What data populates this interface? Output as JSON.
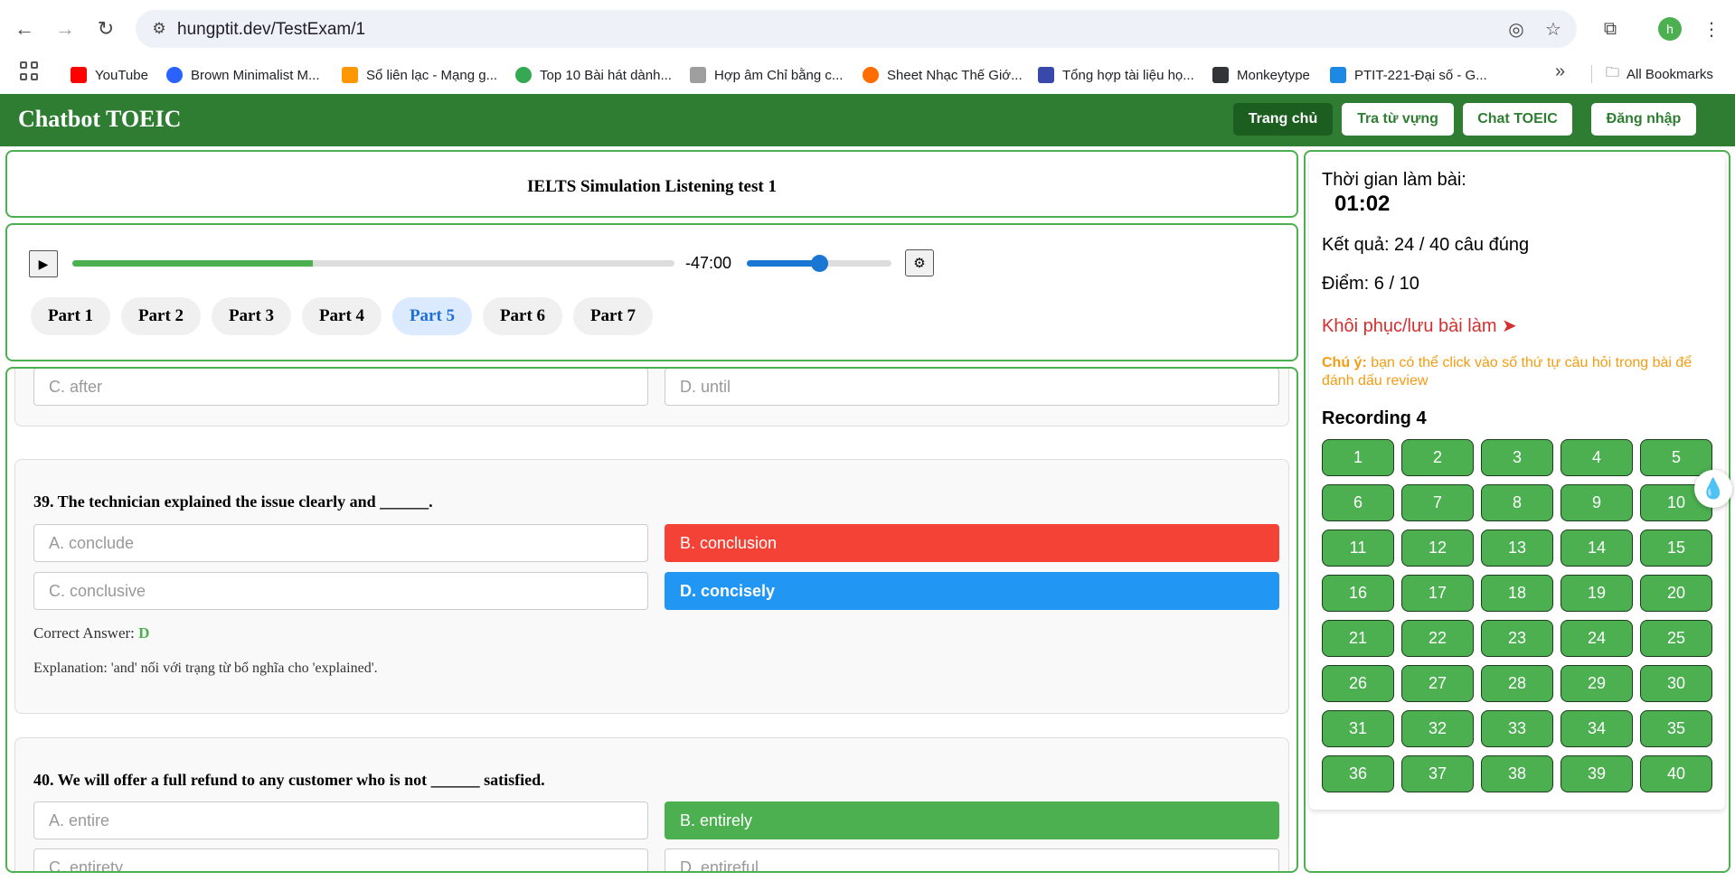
{
  "browser": {
    "url": "hungptit.dev/TestExam/1",
    "profile_initial": "h",
    "icons": {
      "back": "arrow-left-icon",
      "forward": "arrow-right-icon",
      "reload": "reload-icon",
      "site_info": "tune-icon",
      "eye_off": "eye-off-icon",
      "star": "star-icon",
      "extensions": "puzzle-icon",
      "menu": "kebab-menu-icon"
    },
    "bookmarks": [
      {
        "label": "YouTube",
        "color": "#ff0000"
      },
      {
        "label": "Brown Minimalist M...",
        "color": "#2962ff"
      },
      {
        "label": "Sổ liên lạc - Mạng g...",
        "color": "#ff9800"
      },
      {
        "label": "Top 10 Bài hát dành...",
        "color": "#34a853"
      },
      {
        "label": "Hợp âm Chỉ bằng c...",
        "color": "#9e9e9e"
      },
      {
        "label": "Sheet Nhạc Thế Giớ...",
        "color": "#ff6d00"
      },
      {
        "label": "Tổng hợp tài liệu họ...",
        "color": "#3949ab"
      },
      {
        "label": "Monkeytype",
        "color": "#323437"
      },
      {
        "label": "PTIT-221-Đại số - G...",
        "color": "#1e88e5"
      }
    ],
    "all_bookmarks": "All Bookmarks"
  },
  "app": {
    "title": "Chatbot TOEIC",
    "nav": {
      "home": "Trang chủ",
      "vocab": "Tra từ vựng",
      "chat": "Chat TOEIC",
      "login": "Đăng nhập"
    }
  },
  "exam": {
    "title": "IELTS Simulation Listening test 1"
  },
  "player": {
    "time_left": "-47:00",
    "progress": 0.4,
    "volume": 0.5,
    "parts": [
      "Part 1",
      "Part 2",
      "Part 3",
      "Part 4",
      "Part 5",
      "Part 6",
      "Part 7"
    ],
    "active_part": "Part 5"
  },
  "questions": {
    "prev_tail": {
      "c": "C. after",
      "d": "D. until"
    },
    "q39": {
      "text": "39. The technician explained the issue clearly and ______.",
      "a": "A. conclude",
      "b": "B. conclusion",
      "c": "C. conclusive",
      "d": "D. concisely",
      "answer_label": "Correct Answer: ",
      "answer": "D",
      "explanation": "Explanation: 'and' nối với trạng từ bổ nghĩa cho 'explained'."
    },
    "q40": {
      "text": "40. We will offer a full refund to any customer who is not ______ satisfied.",
      "a": "A. entire",
      "b": "B. entirely",
      "c": "C. entirety",
      "d": "D. entireful"
    }
  },
  "sidebar": {
    "time_label": "Thời gian làm bài:",
    "timer": "01:02",
    "result": "Kết quả: 24 / 40 câu đúng",
    "score": "Điểm: 6 / 10",
    "restore": "Khôi phục/lưu bài làm ➤",
    "note_label": "Chú ý:",
    "note_text": " bạn có thể click vào số thứ tự câu hỏi trong bài để đánh dấu review",
    "section": "Recording 4",
    "numbers": [
      "1",
      "2",
      "3",
      "4",
      "5",
      "6",
      "7",
      "8",
      "9",
      "10",
      "11",
      "12",
      "13",
      "14",
      "15",
      "16",
      "17",
      "18",
      "19",
      "20",
      "21",
      "22",
      "23",
      "24",
      "25",
      "26",
      "27",
      "28",
      "29",
      "30",
      "31",
      "32",
      "33",
      "34",
      "35",
      "36",
      "37",
      "38",
      "39",
      "40"
    ]
  },
  "colors": {
    "brand": "#2e7d32",
    "accent": "#4caf50",
    "wrong": "#f44336",
    "chosen": "#2196f3",
    "note": "#f39c12",
    "restore": "#d32f2f"
  }
}
